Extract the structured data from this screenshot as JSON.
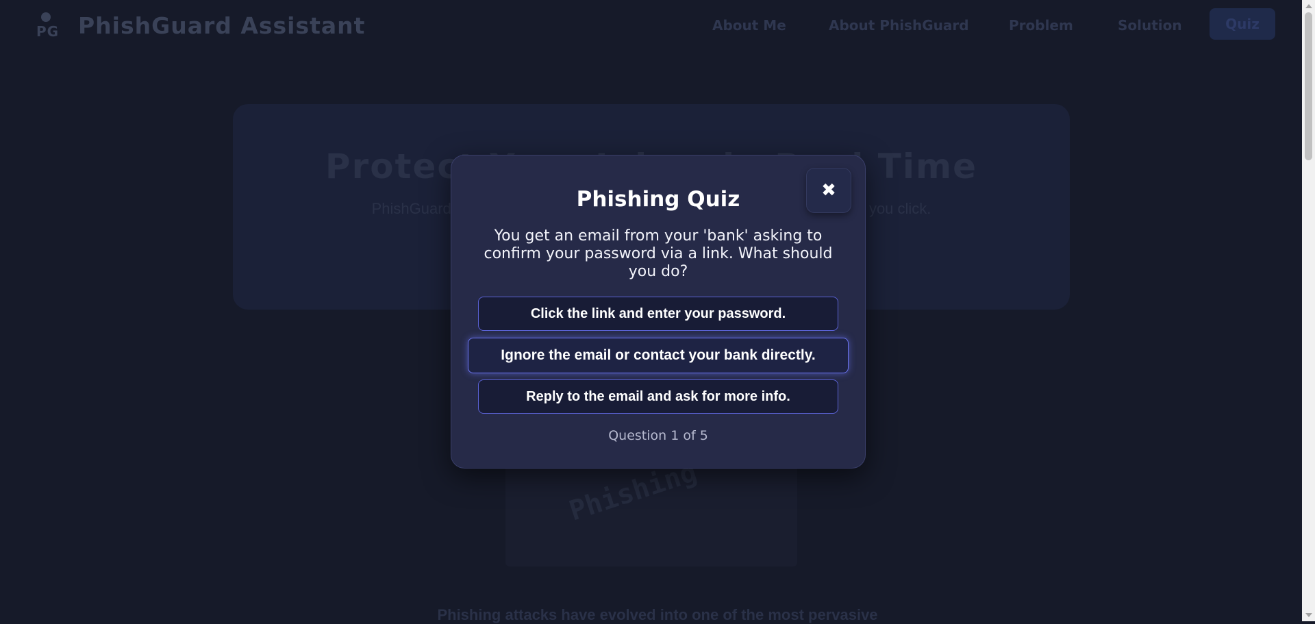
{
  "nav": {
    "logo_text": "PG",
    "brand": "PhishGuard Assistant",
    "links": [
      "About Me",
      "About PhishGuard",
      "Problem",
      "Solution"
    ],
    "quiz_label": "Quiz"
  },
  "hero": {
    "title": "Protect Your Inbox in Real Time",
    "subtitle": "PhishGuard Assistant analyzes your emails to spot phishing scams before you click."
  },
  "background_image": {
    "word": "Phishing"
  },
  "intro_text": "Phishing attacks have evolved into one of the most pervasive",
  "modal": {
    "close_icon": "close-icon",
    "title": "Phishing Quiz",
    "question": "You get an email from your 'bank' asking to confirm your password via a link. What should you do?",
    "options": [
      "Click the link and enter your password.",
      "Ignore the email or contact your bank directly.",
      "Reply to the email and ask for more info."
    ],
    "progress": "Question 1 of 5",
    "current_question": 1,
    "total_questions": 5
  },
  "colors": {
    "page_bg": "#161a29",
    "modal_bg": "#262a48",
    "option_border": "#5b62d6"
  }
}
